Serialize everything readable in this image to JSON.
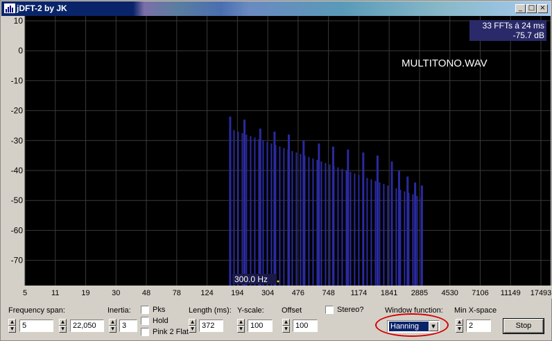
{
  "window": {
    "title": "jDFT-2 by JK",
    "buttons": {
      "minimize": "_",
      "maximize": "□",
      "close": "×"
    }
  },
  "plot": {
    "info_line1": "33 FFTs á 24 ms",
    "info_line2": "-75.7 dB",
    "filename": "MULTITONO.WAV",
    "cursor_label": "300.0 Hz",
    "y_ticks": [
      "10",
      "0",
      "-10",
      "-20",
      "-30",
      "-40",
      "-50",
      "-60",
      "-70"
    ],
    "x_ticks": [
      "5",
      "11",
      "19",
      "30",
      "48",
      "78",
      "124",
      "194",
      "304",
      "476",
      "748",
      "1174",
      "1841",
      "2885",
      "4530",
      "7106",
      "11149",
      "17493"
    ],
    "colors": {
      "background": "#000000",
      "grid": "#3a3a3a",
      "bars": "#2a2aa0",
      "text": "#ffffff"
    }
  },
  "chart_data": {
    "type": "bar",
    "x_scale": "log",
    "x_unit": "Hz",
    "y_unit": "dB",
    "ylim": [
      -80,
      10
    ],
    "xlim": [
      5,
      17493
    ],
    "grid": true,
    "x": [
      100,
      125,
      160,
      200,
      250,
      315,
      400,
      500,
      630,
      800,
      1000,
      1250,
      1400,
      1600,
      1800,
      2000
    ],
    "values": [
      -22,
      -23,
      -26,
      -27,
      -28,
      -30,
      -31,
      -32,
      -33,
      -34,
      -35,
      -37,
      -40,
      -42,
      -44,
      -45
    ],
    "series_envelope": "dense tones between ~100 Hz and ~1900 Hz, levels decreasing from about -22 dB to -45 dB"
  },
  "controls": {
    "freq_span_label": "Frequency span:",
    "freq_span_min": "5",
    "freq_span_max": "22,050",
    "inertia_label": "Inertia:",
    "inertia_value": "3",
    "pks_label": "Pks",
    "hold_label": "Hold",
    "pink_label": "Pink 2 Flat",
    "length_label": "Length (ms):",
    "length_value": "372",
    "yscale_label": "Y-scale:",
    "yscale_value": "100",
    "offset_label": "Offset",
    "offset_value": "100",
    "stereo_label": "Stereo?",
    "window_function_label": "Window function:",
    "window_function_value": "Hanning",
    "min_xspace_label": "Min X-space",
    "min_xspace_value": "2",
    "stop_label": "Stop"
  }
}
